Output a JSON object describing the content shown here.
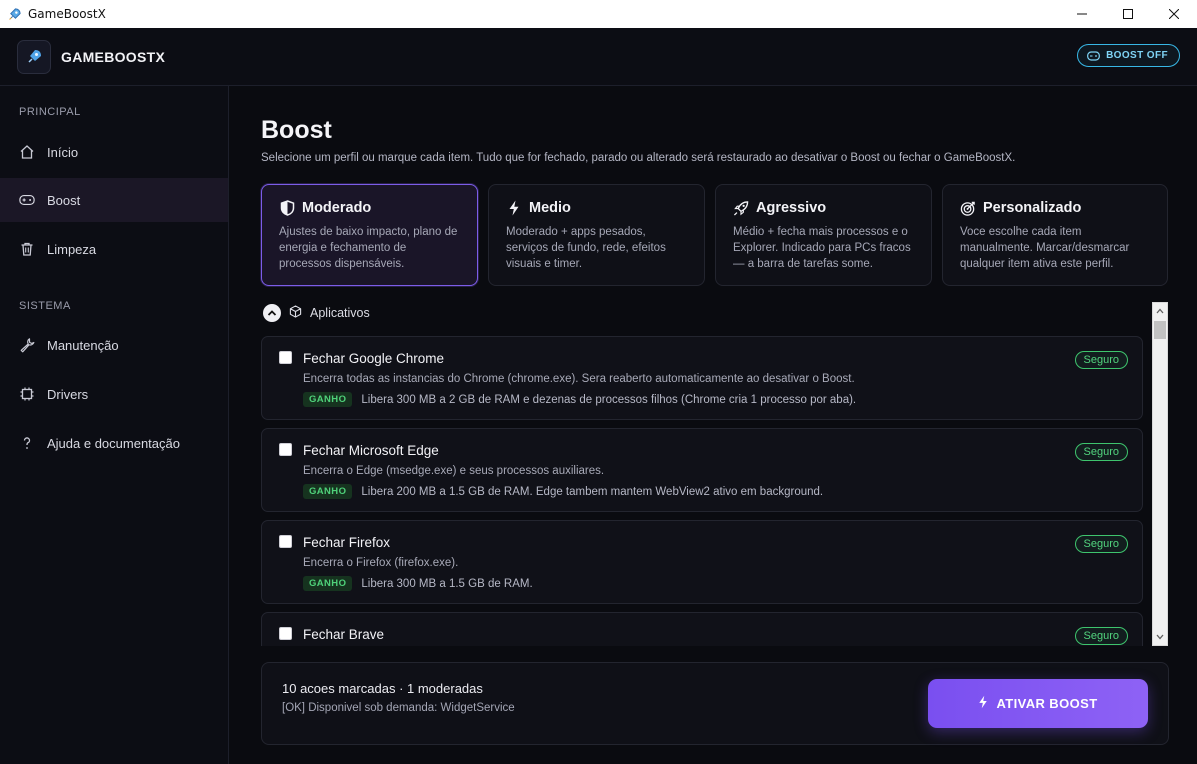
{
  "window": {
    "title": "GameBoostX"
  },
  "header": {
    "brand": "GAMEBOOSTX",
    "boost_status": "BOOST OFF"
  },
  "sidebar": {
    "sections": [
      {
        "label": "PRINCIPAL",
        "items": [
          {
            "label": "Início",
            "icon": "home-icon"
          },
          {
            "label": "Boost",
            "icon": "gamepad-icon",
            "active": true
          },
          {
            "label": "Limpeza",
            "icon": "trash-icon"
          }
        ]
      },
      {
        "label": "SISTEMA",
        "items": [
          {
            "label": "Manutenção",
            "icon": "wrench-icon"
          },
          {
            "label": "Drivers",
            "icon": "chip-icon"
          },
          {
            "label": "Ajuda e documentação",
            "icon": "question-icon"
          }
        ]
      }
    ]
  },
  "main": {
    "title": "Boost",
    "description": "Selecione um perfil ou marque cada item. Tudo que for fechado, parado ou alterado será restaurado ao desativar o Boost ou fechar o GameBoostX.",
    "profiles": [
      {
        "name": "Moderado",
        "icon": "shield-icon",
        "desc": "Ajustes de baixo impacto, plano de energia e fechamento de processos dispensáveis.",
        "selected": true
      },
      {
        "name": "Medio",
        "icon": "bolt-icon",
        "desc": "Moderado + apps pesados, serviços de fundo, rede, efeitos visuais e timer."
      },
      {
        "name": "Agressivo",
        "icon": "rocket-icon",
        "desc": "Médio + fecha mais processos e o Explorer. Indicado para PCs fracos — a barra de tarefas some."
      },
      {
        "name": "Personalizado",
        "icon": "target-icon",
        "desc": "Voce escolhe cada item manualmente. Marcar/desmarcar qualquer item ativa este perfil."
      }
    ],
    "section": {
      "label": "Aplicativos",
      "icon": "box-icon"
    },
    "gain_label": "GANHO",
    "safe_label": "Seguro",
    "items": [
      {
        "title": "Fechar Google Chrome",
        "desc": "Encerra todas as instancias do Chrome (chrome.exe). Sera reaberto automaticamente ao desativar o Boost.",
        "gain": "Libera 300 MB a 2 GB de RAM e dezenas de processos filhos (Chrome cria 1 processo por aba).",
        "checked": false
      },
      {
        "title": "Fechar Microsoft Edge",
        "desc": "Encerra o Edge (msedge.exe) e seus processos auxiliares.",
        "gain": "Libera 200 MB a 1.5 GB de RAM. Edge tambem mantem WebView2 ativo em background.",
        "checked": false
      },
      {
        "title": "Fechar Firefox",
        "desc": "Encerra o Firefox (firefox.exe).",
        "gain": "Libera 300 MB a 1.5 GB de RAM.",
        "checked": false
      },
      {
        "title": "Fechar Brave",
        "desc": "",
        "gain": "",
        "checked": false
      }
    ]
  },
  "footer": {
    "summary": "10 acoes marcadas  ·  1 moderadas",
    "status": "[OK] Disponivel sob demanda: WidgetService",
    "activate_label": "ATIVAR BOOST"
  },
  "colors": {
    "accent": "#7c5ce8",
    "safe": "#3ec46d",
    "status": "#38b7e6"
  }
}
